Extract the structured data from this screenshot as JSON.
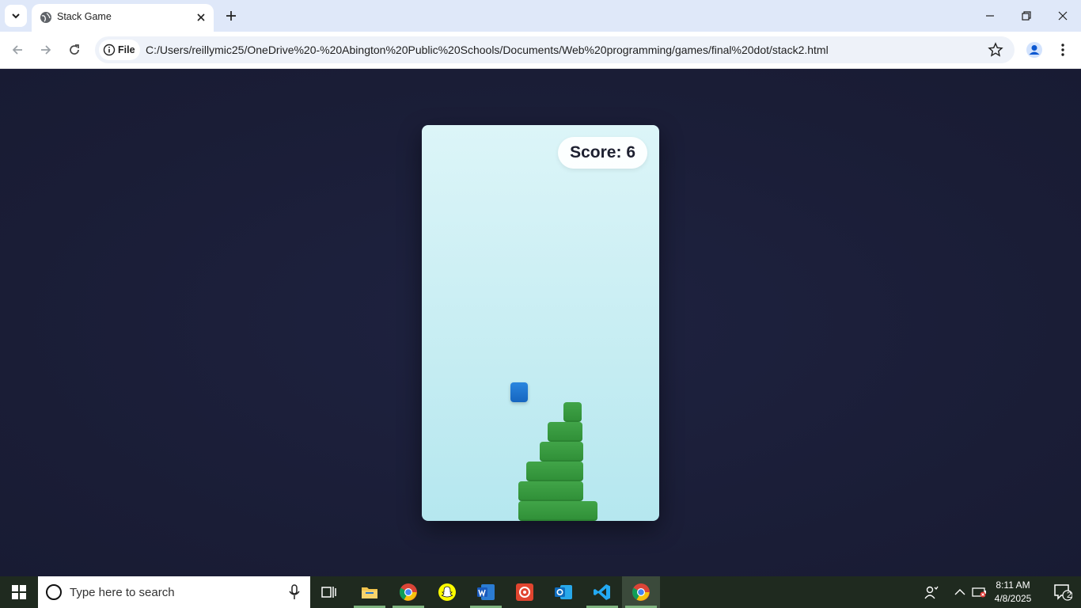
{
  "browser": {
    "tab_title": "Stack Game",
    "site_chip": "File",
    "url": "C:/Users/reillymic25/OneDrive%20-%20Abington%20Public%20Schools/Documents/Web%20programming/games/final%20dot/stack2.html"
  },
  "game": {
    "score_text": "Score: 6",
    "score_value": 6,
    "colors": {
      "block": "#3a9a41",
      "moving_block": "#1a73d4",
      "background_top": "#dcf5f8",
      "background_bottom": "#b5e7ef"
    },
    "stacked_block_count": 6
  },
  "taskbar": {
    "search_placeholder": "Type here to search",
    "time": "8:11 AM",
    "date": "4/8/2025",
    "notification_count": "2",
    "apps": [
      "task-view",
      "file-explorer",
      "chrome",
      "snapchat",
      "word",
      "app-red",
      "outlook",
      "vscode",
      "chrome"
    ]
  }
}
